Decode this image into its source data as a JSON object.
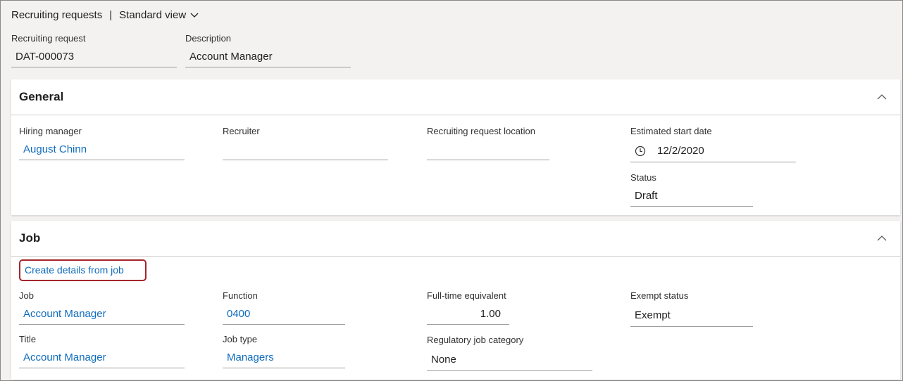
{
  "topbar": {
    "title": "Recruiting requests",
    "separator": "|",
    "view": "Standard view"
  },
  "header_fields": {
    "request_label": "Recruiting request",
    "request_value": "DAT-000073",
    "description_label": "Description",
    "description_value": "Account Manager"
  },
  "general": {
    "title": "General",
    "hiring_manager_label": "Hiring manager",
    "hiring_manager_value": "August Chinn",
    "recruiter_label": "Recruiter",
    "recruiter_value": "",
    "location_label": "Recruiting request location",
    "location_value": "",
    "start_date_label": "Estimated start date",
    "start_date_value": "12/2/2020",
    "status_label": "Status",
    "status_value": "Draft"
  },
  "job": {
    "title": "Job",
    "create_details_link": "Create details from job",
    "job_label": "Job",
    "job_value": "Account Manager",
    "function_label": "Function",
    "function_value": "0400",
    "fte_label": "Full-time equivalent",
    "fte_value": "1.00",
    "exempt_label": "Exempt status",
    "exempt_value": "Exempt",
    "title_label": "Title",
    "title_value": "Account Manager",
    "job_type_label": "Job type",
    "job_type_value": "Managers",
    "regulatory_label": "Regulatory job category",
    "regulatory_value": "None"
  },
  "colors": {
    "link": "#0f6cbd",
    "highlight_border": "#a4262c",
    "background": "#f3f2f1",
    "card": "#ffffff"
  }
}
